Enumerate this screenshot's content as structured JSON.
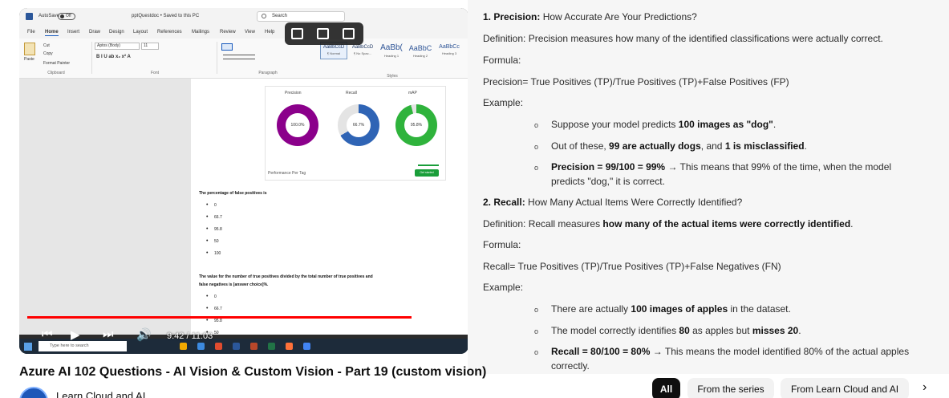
{
  "video": {
    "word": {
      "autosave_label": "AutoSave",
      "autosave_state": "Off",
      "doc_name": "pptQuestdoc • Saved to this PC",
      "search_placeholder": "Search",
      "tabs": [
        "File",
        "Home",
        "Insert",
        "Draw",
        "Design",
        "Layout",
        "References",
        "Mailings",
        "Review",
        "View",
        "Help"
      ],
      "active_tab": "Home",
      "clipboard": {
        "paste": "Paste",
        "cut": "Cut",
        "copy": "Copy",
        "format_painter": "Format Painter",
        "label": "Clipboard"
      },
      "font": {
        "name": "Aptos (Body)",
        "size": "11",
        "label": "Font",
        "buttons": "B  I  U  ab  x₂  x²  A"
      },
      "paragraph_label": "Paragraph",
      "styles_label": "Styles",
      "styles": [
        {
          "sample": "AaBbCcD",
          "name": "¶ Normal"
        },
        {
          "sample": "AaBbCcD",
          "name": "¶ No Spac..."
        },
        {
          "sample": "AaBb(",
          "name": "Heading 1"
        },
        {
          "sample": "AaBbC",
          "name": "Heading 2"
        },
        {
          "sample": "AaBbCc",
          "name": "Heading 3"
        }
      ]
    },
    "doc": {
      "side_note": "Iteration 1  Trained: 40 minutes ago with General domain",
      "dashboard": {
        "metrics": [
          {
            "label": "Precision",
            "value": "100.0%",
            "percent": 100,
            "color": "#8b008b"
          },
          {
            "label": "Recall",
            "value": "66.7%",
            "percent": 66.7,
            "color": "#2f64b5"
          },
          {
            "label": "mAP",
            "value": "95.8%",
            "percent": 95.8,
            "color": "#2fb33c"
          }
        ],
        "perf_label": "Performance Per Tag",
        "get_started": "Get started"
      },
      "q1": "The percentage of false positives is",
      "q1_options": [
        "0",
        "66.7",
        "95.8",
        "50",
        "100"
      ],
      "q2_line1": "The value for the number of true positives divided by the total number of true positives and",
      "q2_line2": "false negatives is [answer choice]%.",
      "q2_options": [
        "0",
        "66.7",
        "95.8",
        "50"
      ]
    },
    "player": {
      "current_time": "9:42",
      "duration": "11:03",
      "time_display": "9:42 / 11:03",
      "progress_fraction": 0.878
    },
    "taskbar": {
      "search_placeholder": "Type here to search"
    }
  },
  "notes": {
    "h1_num": "1. Precision:",
    "h1_rest": " How Accurate Are Your Predictions?",
    "def1": "Definition: Precision measures how many of the identified classifications were actually correct.",
    "formula_label": "Formula:",
    "formula1": "Precision= True Positives (TP)/True Positives (TP)+False Positives (FP)",
    "example_label": "Example:",
    "ex1_a_pre": "Suppose your model predicts ",
    "ex1_a_bold": "100 images as \"dog\"",
    "ex1_a_post": ".",
    "ex1_b_pre": "Out of these, ",
    "ex1_b_bold1": "99 are actually dogs",
    "ex1_b_mid": ", and ",
    "ex1_b_bold2": "1 is misclassified",
    "ex1_b_post": ".",
    "ex1_c_bold": "Precision = 99/100 = 99%",
    "ex1_c_post": " → This means that 99% of the time, when the model",
    "ex1_c_line2": "predicts \"dog,\" it is correct.",
    "h2_num": "2. Recall:",
    "h2_rest": " How Many Actual Items Were Correctly Identified?",
    "def2_pre": "Definition: Recall measures ",
    "def2_bold": "how many of the actual items were correctly identified",
    "def2_post": ".",
    "formula2": "Recall= True Positives (TP)/True Positives (TP)+False Negatives (FN)",
    "ex2_a_pre": "There are actually ",
    "ex2_a_bold": "100 images of apples",
    "ex2_a_post": " in the dataset.",
    "ex2_b_pre": "The model correctly identifies ",
    "ex2_b_bold1": "80",
    "ex2_b_mid": " as apples but ",
    "ex2_b_bold2": "misses 20",
    "ex2_b_post": ".",
    "ex2_c_bold": "Recall = 80/100 = 80%",
    "ex2_c_post": " → This means the model identified 80% of the actual apples",
    "ex2_c_line2": "correctly."
  },
  "page": {
    "video_title": "Azure AI 102 Questions - AI Vision & Custom Vision - Part 19 (custom vision)",
    "channel_name": "Learn Cloud and AI"
  },
  "chips": [
    "All",
    "From the series",
    "From Learn Cloud and AI"
  ],
  "colors": {
    "progress": "#ff0000",
    "chip_active": "#0f0f0f",
    "chip": "#f2f2f2"
  }
}
